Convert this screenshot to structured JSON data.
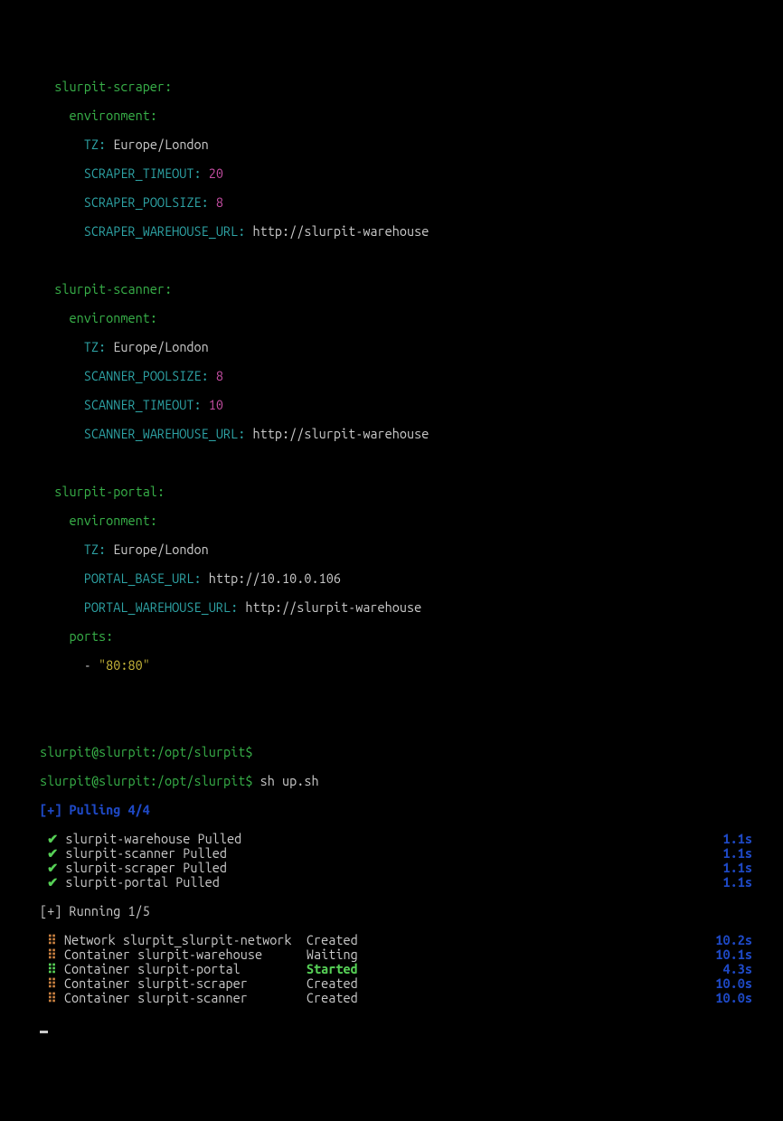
{
  "yaml": {
    "scraper": {
      "name": "slurpit-scraper",
      "env_label": "environment",
      "tz_key": "TZ",
      "tz_val": "Europe/London",
      "timeout_key": "SCRAPER_TIMEOUT",
      "timeout_val": "20",
      "poolsize_key": "SCRAPER_POOLSIZE",
      "poolsize_val": "8",
      "wh_key": "SCRAPER_WAREHOUSE_URL",
      "wh_val": "http://slurpit-warehouse"
    },
    "scanner": {
      "name": "slurpit-scanner",
      "env_label": "environment",
      "tz_key": "TZ",
      "tz_val": "Europe/London",
      "poolsize_key": "SCANNER_POOLSIZE",
      "poolsize_val": "8",
      "timeout_key": "SCANNER_TIMEOUT",
      "timeout_val": "10",
      "wh_key": "SCANNER_WAREHOUSE_URL",
      "wh_val": "http://slurpit-warehouse"
    },
    "portal": {
      "name": "slurpit-portal",
      "env_label": "environment",
      "tz_key": "TZ",
      "tz_val": "Europe/London",
      "base_key": "PORTAL_BASE_URL",
      "base_val": "http://10.10.0.106",
      "wh_key": "PORTAL_WAREHOUSE_URL",
      "wh_val": "http://slurpit-warehouse",
      "ports_label": "ports",
      "ports_val": "\"80:80\""
    }
  },
  "prompt_empty": "slurpit@slurpit:/opt/slurpit$",
  "prompt_cmd": "slurpit@slurpit:/opt/slurpit$",
  "cmd": "sh up.sh",
  "pull_header": "[+] Pulling 4/4",
  "pulls": [
    {
      "name": "slurpit-warehouse Pulled",
      "time": "1.1s"
    },
    {
      "name": "slurpit-scanner Pulled",
      "time": "1.1s"
    },
    {
      "name": "slurpit-scraper Pulled",
      "time": "1.1s"
    },
    {
      "name": "slurpit-portal Pulled",
      "time": "1.1s"
    }
  ],
  "run_header": "[+] Running 1/5",
  "runs": [
    {
      "mark": "or",
      "name": "Network slurpit_slurpit-network",
      "status": "Created",
      "statusClass": "w",
      "time": "10.2s"
    },
    {
      "mark": "or",
      "name": "Container slurpit-warehouse",
      "status": "Waiting",
      "statusClass": "w",
      "time": "10.1s"
    },
    {
      "mark": "bg",
      "name": "Container slurpit-portal",
      "status": "Started",
      "statusClass": "bg",
      "time": "4.3s"
    },
    {
      "mark": "or",
      "name": "Container slurpit-scraper",
      "status": "Created",
      "statusClass": "w",
      "time": "10.0s"
    },
    {
      "mark": "or",
      "name": "Container slurpit-scanner",
      "status": "Created",
      "statusClass": "w",
      "time": "10.0s"
    }
  ]
}
